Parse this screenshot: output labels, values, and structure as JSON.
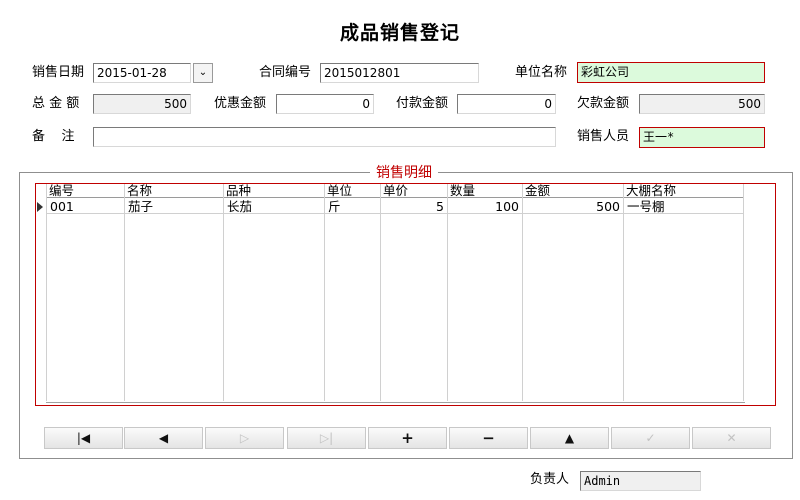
{
  "window": {
    "title": "成品销售登记"
  },
  "form": {
    "sale_date": {
      "label": "销售日期",
      "value": "2015-01-28",
      "spin_glyph": "⌄"
    },
    "contract_no": {
      "label": "合同编号",
      "value": "2015012801"
    },
    "unit_name": {
      "label": "单位名称",
      "value": "彩虹公司"
    },
    "total_amount": {
      "label": "总 金 额",
      "value": "500"
    },
    "discount": {
      "label": "优惠金额",
      "value": "0"
    },
    "paid": {
      "label": "付款金额",
      "value": "0"
    },
    "owed": {
      "label": "欠款金额",
      "value": "500"
    },
    "remark": {
      "label": "备    注",
      "value": ""
    },
    "salesperson": {
      "label": "销售人员",
      "value": "王一*"
    }
  },
  "details": {
    "legend": "销售明细",
    "columns": [
      "编号",
      "名称",
      "品种",
      "单位",
      "单价",
      "数量",
      "金额",
      "大棚名称"
    ],
    "rows": [
      {
        "code": "001",
        "name": "茄子",
        "variety": "长茄",
        "unit": "斤",
        "price": "5",
        "qty": "100",
        "amount": "500",
        "greenhouse": "一号棚"
      }
    ]
  },
  "nav": {
    "first": "|◀",
    "prev": "◀",
    "next": "▷",
    "last": "▷|",
    "add": "+",
    "delete": "−",
    "up": "▲",
    "confirm": "✓",
    "cancel": "✕"
  },
  "footer": {
    "label": "负责人",
    "value": "Admin"
  },
  "colors": {
    "accent_red": "#c00000",
    "highlight_green": "#dcfadc",
    "readonly_gray": "#f0f0f0"
  }
}
